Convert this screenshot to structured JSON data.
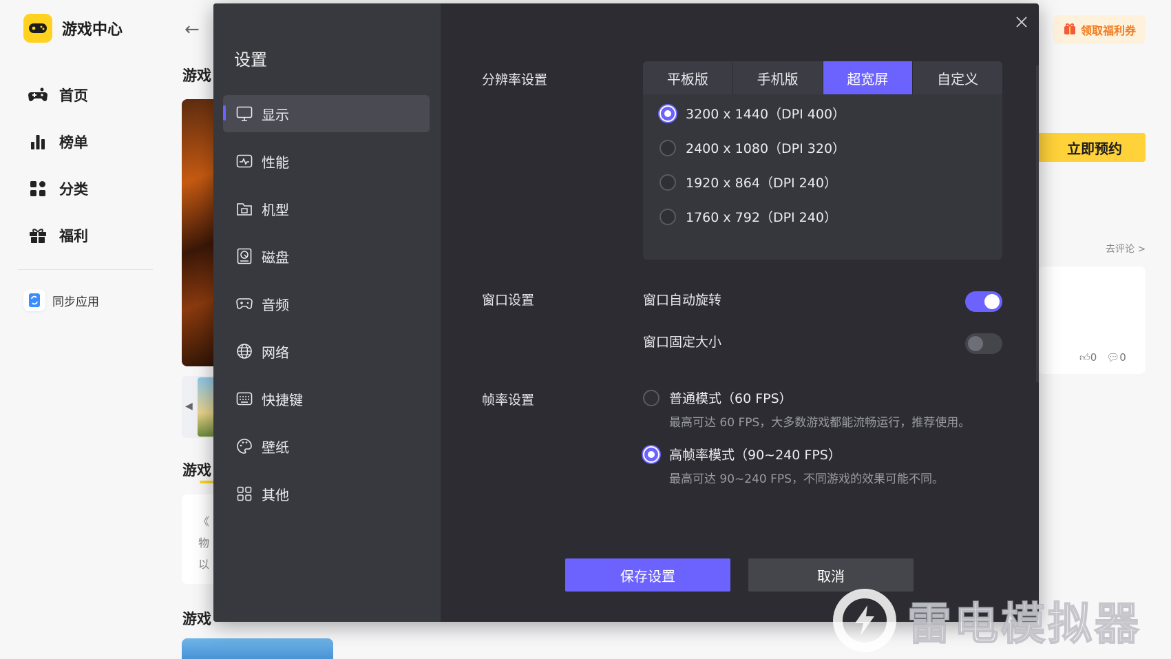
{
  "app": {
    "title": "游戏中心",
    "nav": [
      {
        "label": "首页",
        "icon": "gamepad-icon"
      },
      {
        "label": "榜单",
        "icon": "ranking-icon"
      },
      {
        "label": "分类",
        "icon": "category-icon"
      },
      {
        "label": "福利",
        "icon": "gift-icon"
      }
    ],
    "sync_label": "同步应用"
  },
  "background": {
    "section_titles": [
      "游戏",
      "游戏",
      "游戏"
    ],
    "article_lines": [
      "《",
      "物",
      "以"
    ],
    "coupon_label": "领取福利券",
    "reserve_label": "立即预约",
    "comment_link": "去评论 >",
    "likes": "0",
    "comments": "0"
  },
  "dialog": {
    "title": "设置",
    "menu": [
      {
        "label": "显示",
        "icon": "monitor-icon",
        "active": true
      },
      {
        "label": "性能",
        "icon": "performance-icon",
        "active": false
      },
      {
        "label": "机型",
        "icon": "device-model-icon",
        "active": false
      },
      {
        "label": "磁盘",
        "icon": "disk-icon",
        "active": false
      },
      {
        "label": "音频",
        "icon": "audio-icon",
        "active": false
      },
      {
        "label": "网络",
        "icon": "globe-icon",
        "active": false
      },
      {
        "label": "快捷键",
        "icon": "keyboard-icon",
        "active": false
      },
      {
        "label": "壁纸",
        "icon": "palette-icon",
        "active": false
      },
      {
        "label": "其他",
        "icon": "grid-icon",
        "active": false
      }
    ],
    "resolution": {
      "label": "分辨率设置",
      "tabs": [
        "平板版",
        "手机版",
        "超宽屏",
        "自定义"
      ],
      "active_tab": "超宽屏",
      "options": [
        {
          "text": "3200 x 1440（DPI 400）",
          "selected": true
        },
        {
          "text": "2400 x 1080（DPI 320）",
          "selected": false
        },
        {
          "text": "1920 x 864（DPI 240）",
          "selected": false
        },
        {
          "text": "1760 x 792（DPI 240）",
          "selected": false
        }
      ]
    },
    "window": {
      "label": "窗口设置",
      "auto_rotate": {
        "label": "窗口自动旋转",
        "on": true
      },
      "fixed_size": {
        "label": "窗口固定大小",
        "on": false
      }
    },
    "framerate": {
      "label": "帧率设置",
      "normal": {
        "title": "普通模式（60 FPS）",
        "desc": "最高可达 60 FPS，大多数游戏都能流畅运行，推荐使用。",
        "selected": false
      },
      "high": {
        "title": "高帧率模式（90~240 FPS）",
        "desc": "最高可达 90~240 FPS，不同游戏的效果可能不同。",
        "selected": true
      }
    },
    "save_label": "保存设置",
    "cancel_label": "取消"
  },
  "watermark": "雷电模拟器",
  "colors": {
    "accent": "#6c63ff",
    "dialog_bg": "#2c2c32",
    "dialog_sidebar": "#38383f",
    "brand_yellow": "#ffd21f"
  }
}
